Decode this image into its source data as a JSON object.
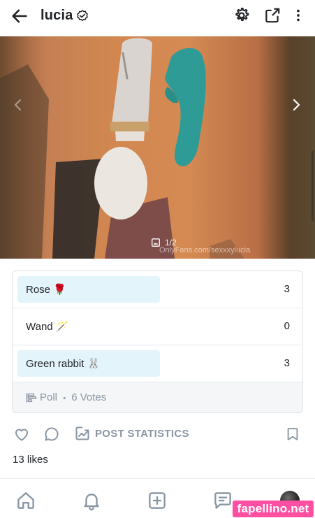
{
  "header": {
    "username": "lucia"
  },
  "media": {
    "counter": "1/2",
    "watermark": "OnlyFans.com/sexxxylucia"
  },
  "poll": {
    "options": [
      {
        "label": "Rose 🌹",
        "votes": "3",
        "fraction": 0.5
      },
      {
        "label": "Wand 🪄",
        "votes": "0",
        "fraction": 0
      },
      {
        "label": "Green rabbit 🐰",
        "votes": "3",
        "fraction": 0.5
      }
    ],
    "footer_label": "Poll",
    "separator": "•",
    "votes_label": "6 Votes"
  },
  "actions": {
    "stats_label": "POST STATISTICS"
  },
  "likes": "13 likes",
  "site_badge": "fapellino.net",
  "colors": {
    "poll_fill": "#e3f4fa",
    "muted": "#8a96a3",
    "badge": "#ff4fa3"
  }
}
